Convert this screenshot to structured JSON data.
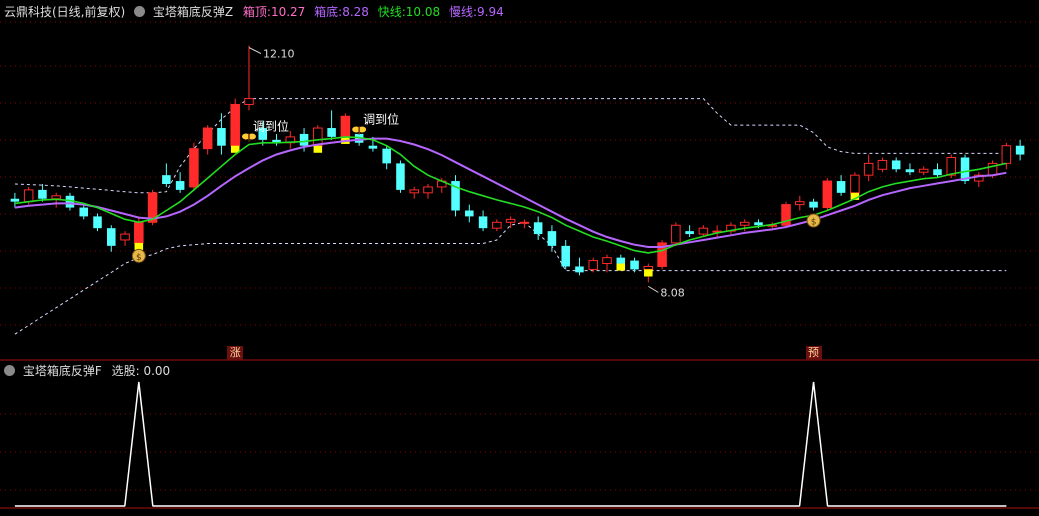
{
  "header": {
    "stock_label": "云鼎科技(日线,前复权)",
    "indicator_name": "宝塔箱底反弹Z",
    "box_top_label": "箱顶:",
    "box_top_value": "10.27",
    "box_bottom_label": "箱底:",
    "box_bottom_value": "8.28",
    "fast_label": "快线:",
    "fast_value": "10.08",
    "slow_label": "慢线:",
    "slow_value": "9.94"
  },
  "lower_header": {
    "indicator_name": "宝塔箱底反弹F",
    "select_label": "选股:",
    "select_value": "0.00"
  },
  "annotations": {
    "high_label": "12.10",
    "low_label": "8.08",
    "adjust_text_1": "调到位",
    "adjust_text_2": "调到位",
    "marker_rise": "涨",
    "marker_predict": "预"
  },
  "colors": {
    "up": "#ff2a2a",
    "down": "#54ffff",
    "yellow": "#ffff00",
    "fast_line": "#22dd22",
    "slow_line": "#b566ff",
    "box_line": "#d8d8ff",
    "grid": "#8b0000",
    "legend_top": "#ff6ec7",
    "legend_bottom": "#b566ff"
  },
  "chart_data": {
    "type": "candlestick",
    "ylim": [
      7.0,
      12.5
    ],
    "candles": [
      {
        "o": 9.5,
        "h": 9.6,
        "l": 9.35,
        "c": 9.45
      },
      {
        "o": 9.45,
        "h": 9.7,
        "l": 9.4,
        "c": 9.65
      },
      {
        "o": 9.65,
        "h": 9.75,
        "l": 9.45,
        "c": 9.5
      },
      {
        "o": 9.5,
        "h": 9.6,
        "l": 9.35,
        "c": 9.55
      },
      {
        "o": 9.55,
        "h": 9.6,
        "l": 9.3,
        "c": 9.35
      },
      {
        "o": 9.35,
        "h": 9.4,
        "l": 9.15,
        "c": 9.2
      },
      {
        "o": 9.2,
        "h": 9.25,
        "l": 8.95,
        "c": 9.0
      },
      {
        "o": 9.0,
        "h": 9.05,
        "l": 8.6,
        "c": 8.7
      },
      {
        "o": 8.8,
        "h": 8.95,
        "l": 8.7,
        "c": 8.9
      },
      {
        "o": 8.75,
        "h": 9.2,
        "l": 8.7,
        "c": 9.1
      },
      {
        "o": 9.1,
        "h": 9.65,
        "l": 9.05,
        "c": 9.6
      },
      {
        "o": 9.9,
        "h": 10.1,
        "l": 9.7,
        "c": 9.75
      },
      {
        "o": 9.8,
        "h": 9.95,
        "l": 9.6,
        "c": 9.65
      },
      {
        "o": 9.7,
        "h": 10.45,
        "l": 9.65,
        "c": 10.35
      },
      {
        "o": 10.35,
        "h": 10.75,
        "l": 10.25,
        "c": 10.7
      },
      {
        "o": 10.7,
        "h": 10.95,
        "l": 10.25,
        "c": 10.4
      },
      {
        "o": 10.4,
        "h": 11.2,
        "l": 10.35,
        "c": 11.1
      },
      {
        "o": 11.1,
        "h": 12.1,
        "l": 11.0,
        "c": 11.2
      },
      {
        "o": 10.7,
        "h": 10.8,
        "l": 10.4,
        "c": 10.5
      },
      {
        "o": 10.5,
        "h": 10.6,
        "l": 10.4,
        "c": 10.45
      },
      {
        "o": 10.45,
        "h": 10.65,
        "l": 10.35,
        "c": 10.55
      },
      {
        "o": 10.6,
        "h": 10.7,
        "l": 10.3,
        "c": 10.4
      },
      {
        "o": 10.4,
        "h": 10.75,
        "l": 10.35,
        "c": 10.7
      },
      {
        "o": 10.7,
        "h": 11.0,
        "l": 10.5,
        "c": 10.55
      },
      {
        "o": 10.55,
        "h": 10.95,
        "l": 10.5,
        "c": 10.9
      },
      {
        "o": 10.6,
        "h": 10.7,
        "l": 10.4,
        "c": 10.45
      },
      {
        "o": 10.4,
        "h": 10.55,
        "l": 10.3,
        "c": 10.35
      },
      {
        "o": 10.35,
        "h": 10.4,
        "l": 10.0,
        "c": 10.1
      },
      {
        "o": 10.1,
        "h": 10.15,
        "l": 9.6,
        "c": 9.65
      },
      {
        "o": 9.6,
        "h": 9.7,
        "l": 9.5,
        "c": 9.65
      },
      {
        "o": 9.6,
        "h": 9.75,
        "l": 9.5,
        "c": 9.7
      },
      {
        "o": 9.7,
        "h": 9.85,
        "l": 9.6,
        "c": 9.8
      },
      {
        "o": 9.8,
        "h": 9.9,
        "l": 9.2,
        "c": 9.3
      },
      {
        "o": 9.3,
        "h": 9.4,
        "l": 9.1,
        "c": 9.2
      },
      {
        "o": 9.2,
        "h": 9.3,
        "l": 8.95,
        "c": 9.0
      },
      {
        "o": 9.0,
        "h": 9.15,
        "l": 8.95,
        "c": 9.1
      },
      {
        "o": 9.1,
        "h": 9.2,
        "l": 9.0,
        "c": 9.15
      },
      {
        "o": 9.1,
        "h": 9.15,
        "l": 9.0,
        "c": 9.1
      },
      {
        "o": 9.1,
        "h": 9.2,
        "l": 8.8,
        "c": 8.9
      },
      {
        "o": 8.95,
        "h": 9.05,
        "l": 8.6,
        "c": 8.7
      },
      {
        "o": 8.7,
        "h": 8.8,
        "l": 8.3,
        "c": 8.35
      },
      {
        "o": 8.35,
        "h": 8.5,
        "l": 8.2,
        "c": 8.25
      },
      {
        "o": 8.3,
        "h": 8.5,
        "l": 8.25,
        "c": 8.45
      },
      {
        "o": 8.4,
        "h": 8.55,
        "l": 8.25,
        "c": 8.5
      },
      {
        "o": 8.5,
        "h": 8.55,
        "l": 8.35,
        "c": 8.4
      },
      {
        "o": 8.45,
        "h": 8.5,
        "l": 8.25,
        "c": 8.3
      },
      {
        "o": 8.3,
        "h": 8.4,
        "l": 8.08,
        "c": 8.35
      },
      {
        "o": 8.35,
        "h": 8.8,
        "l": 8.3,
        "c": 8.75
      },
      {
        "o": 8.75,
        "h": 9.1,
        "l": 8.7,
        "c": 9.05
      },
      {
        "o": 8.95,
        "h": 9.05,
        "l": 8.85,
        "c": 8.9
      },
      {
        "o": 8.9,
        "h": 9.05,
        "l": 8.85,
        "c": 9.0
      },
      {
        "o": 8.95,
        "h": 9.05,
        "l": 8.85,
        "c": 8.95
      },
      {
        "o": 8.95,
        "h": 9.1,
        "l": 8.9,
        "c": 9.05
      },
      {
        "o": 9.05,
        "h": 9.15,
        "l": 8.95,
        "c": 9.1
      },
      {
        "o": 9.1,
        "h": 9.15,
        "l": 9.0,
        "c": 9.05
      },
      {
        "o": 9.05,
        "h": 9.1,
        "l": 9.0,
        "c": 9.05
      },
      {
        "o": 9.05,
        "h": 9.45,
        "l": 9.0,
        "c": 9.4
      },
      {
        "o": 9.4,
        "h": 9.55,
        "l": 9.3,
        "c": 9.45
      },
      {
        "o": 9.45,
        "h": 9.5,
        "l": 9.3,
        "c": 9.35
      },
      {
        "o": 9.35,
        "h": 9.85,
        "l": 9.3,
        "c": 9.8
      },
      {
        "o": 9.8,
        "h": 9.9,
        "l": 9.55,
        "c": 9.6
      },
      {
        "o": 9.6,
        "h": 9.95,
        "l": 9.55,
        "c": 9.9
      },
      {
        "o": 9.9,
        "h": 10.25,
        "l": 9.8,
        "c": 10.1
      },
      {
        "o": 10.0,
        "h": 10.2,
        "l": 9.95,
        "c": 10.15
      },
      {
        "o": 10.15,
        "h": 10.2,
        "l": 9.95,
        "c": 10.0
      },
      {
        "o": 10.0,
        "h": 10.1,
        "l": 9.9,
        "c": 9.95
      },
      {
        "o": 9.95,
        "h": 10.05,
        "l": 9.9,
        "c": 10.0
      },
      {
        "o": 10.0,
        "h": 10.1,
        "l": 9.85,
        "c": 9.9
      },
      {
        "o": 9.9,
        "h": 10.25,
        "l": 9.85,
        "c": 10.2
      },
      {
        "o": 10.2,
        "h": 10.25,
        "l": 9.75,
        "c": 9.8
      },
      {
        "o": 9.8,
        "h": 9.95,
        "l": 9.7,
        "c": 9.9
      },
      {
        "o": 9.9,
        "h": 10.15,
        "l": 9.85,
        "c": 10.1
      },
      {
        "o": 10.1,
        "h": 10.45,
        "l": 10.0,
        "c": 10.4
      },
      {
        "o": 10.4,
        "h": 10.5,
        "l": 10.15,
        "c": 10.25
      }
    ],
    "yellow_bars": [
      9,
      16,
      22,
      24,
      44,
      46,
      61
    ],
    "fast_line": [
      9.42,
      9.45,
      9.48,
      9.49,
      9.47,
      9.42,
      9.35,
      9.25,
      9.15,
      9.1,
      9.15,
      9.3,
      9.45,
      9.65,
      9.85,
      10.05,
      10.25,
      10.42,
      10.45,
      10.45,
      10.46,
      10.47,
      10.5,
      10.52,
      10.55,
      10.54,
      10.5,
      10.4,
      10.25,
      10.05,
      9.9,
      9.8,
      9.7,
      9.62,
      9.55,
      9.48,
      9.42,
      9.36,
      9.28,
      9.18,
      9.05,
      8.95,
      8.85,
      8.78,
      8.7,
      8.62,
      8.58,
      8.62,
      8.72,
      8.8,
      8.86,
      8.92,
      8.96,
      9.0,
      9.03,
      9.06,
      9.12,
      9.18,
      9.22,
      9.3,
      9.4,
      9.5,
      9.62,
      9.7,
      9.76,
      9.8,
      9.84,
      9.86,
      9.92,
      9.96,
      10.0,
      10.05,
      10.1
    ],
    "slow_line": [
      9.35,
      9.38,
      9.4,
      9.42,
      9.42,
      9.4,
      9.36,
      9.3,
      9.24,
      9.18,
      9.16,
      9.2,
      9.28,
      9.4,
      9.55,
      9.72,
      9.88,
      10.02,
      10.15,
      10.25,
      10.32,
      10.38,
      10.42,
      10.45,
      10.48,
      10.5,
      10.52,
      10.52,
      10.48,
      10.42,
      10.34,
      10.24,
      10.12,
      10.0,
      9.88,
      9.76,
      9.64,
      9.52,
      9.4,
      9.28,
      9.16,
      9.05,
      8.94,
      8.85,
      8.78,
      8.72,
      8.68,
      8.68,
      8.72,
      8.76,
      8.8,
      8.84,
      8.88,
      8.92,
      8.95,
      8.98,
      9.02,
      9.08,
      9.14,
      9.22,
      9.3,
      9.38,
      9.48,
      9.56,
      9.62,
      9.68,
      9.72,
      9.76,
      9.8,
      9.84,
      9.88,
      9.9,
      9.94
    ],
    "box_top": [
      9.75,
      9.74,
      9.73,
      9.72,
      9.7,
      9.68,
      9.66,
      9.64,
      9.62,
      9.6,
      9.6,
      9.62,
      10.05,
      10.35,
      10.6,
      10.85,
      11.05,
      11.2,
      11.2,
      11.2,
      11.2,
      11.2,
      11.2,
      11.2,
      11.2,
      11.2,
      11.2,
      11.2,
      11.2,
      11.2,
      11.2,
      11.2,
      11.2,
      11.2,
      11.2,
      11.2,
      11.2,
      11.2,
      11.2,
      11.2,
      11.2,
      11.2,
      11.2,
      11.2,
      11.2,
      11.2,
      11.2,
      11.2,
      11.2,
      11.2,
      11.2,
      10.95,
      10.75,
      10.75,
      10.75,
      10.75,
      10.75,
      10.75,
      10.62,
      10.38,
      10.3,
      10.27,
      10.27,
      10.27,
      10.27,
      10.27,
      10.27,
      10.27,
      10.27,
      10.27,
      10.27,
      10.27,
      10.27
    ],
    "box_bottom": [
      7.2,
      7.35,
      7.5,
      7.65,
      7.8,
      7.95,
      8.1,
      8.25,
      8.4,
      8.5,
      8.55,
      8.65,
      8.7,
      8.72,
      8.74,
      8.74,
      8.74,
      8.74,
      8.74,
      8.74,
      8.74,
      8.74,
      8.74,
      8.74,
      8.74,
      8.74,
      8.74,
      8.74,
      8.74,
      8.74,
      8.74,
      8.74,
      8.74,
      8.74,
      8.74,
      8.8,
      9.05,
      9.1,
      8.9,
      8.7,
      8.28,
      8.28,
      8.28,
      8.28,
      8.28,
      8.28,
      8.28,
      8.28,
      8.28,
      8.28,
      8.28,
      8.28,
      8.28,
      8.28,
      8.28,
      8.28,
      8.28,
      8.28,
      8.28,
      8.28,
      8.28,
      8.28,
      8.28,
      8.28,
      8.28,
      8.28,
      8.28,
      8.28,
      8.28,
      8.28,
      8.28,
      8.28,
      8.28
    ],
    "butterfly_at": [
      17,
      25
    ],
    "moneybag_at": [
      9,
      58
    ],
    "marker_rise_at": 16,
    "marker_predict_at": 58,
    "select_signal": [
      0,
      0,
      0,
      0,
      0,
      0,
      0,
      0,
      0,
      1,
      0,
      0,
      0,
      0,
      0,
      0,
      0,
      0,
      0,
      0,
      0,
      0,
      0,
      0,
      0,
      0,
      0,
      0,
      0,
      0,
      0,
      0,
      0,
      0,
      0,
      0,
      0,
      0,
      0,
      0,
      0,
      0,
      0,
      0,
      0,
      0,
      0,
      0,
      0,
      0,
      0,
      0,
      0,
      0,
      0,
      0,
      0,
      0,
      1,
      0,
      0,
      0,
      0,
      0,
      0,
      0,
      0,
      0,
      0,
      0,
      0,
      0,
      0
    ]
  }
}
